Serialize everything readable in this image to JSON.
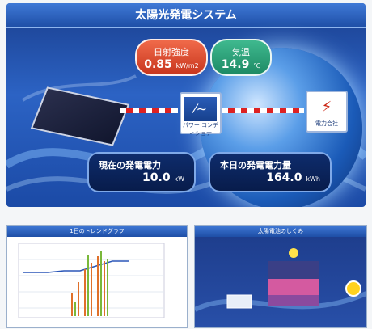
{
  "main": {
    "title": "太陽光発電システム",
    "metrics": {
      "irradiance": {
        "label": "日射強度",
        "value": "0.85",
        "unit": "kW/m2",
        "color": "#d8462a"
      },
      "temperature": {
        "label": "気温",
        "value": "14.9",
        "unit": "℃",
        "color": "#2aa878"
      }
    },
    "pcs_caption": "パワー\nコンディショナ",
    "grid_caption": "電力会社",
    "readouts": {
      "current": {
        "label": "現在の発電電力",
        "value": "10.0",
        "unit": "kW"
      },
      "today": {
        "label": "本日の発電電力量",
        "value": "164.0",
        "unit": "kWh"
      }
    }
  },
  "thumbnails": {
    "trend": {
      "title": "1日のトレンドグラフ"
    },
    "mechanism": {
      "title": "太陽電池のしくみ"
    }
  }
}
